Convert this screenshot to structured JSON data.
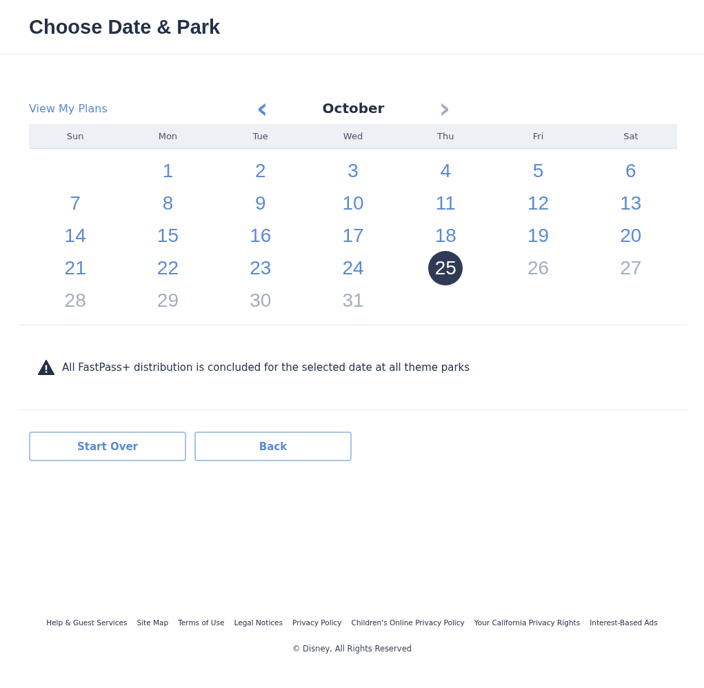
{
  "header": {
    "title": "Choose Date & Park"
  },
  "calendar": {
    "link": "View My Plans",
    "month": "October",
    "prev": {
      "label": "‹",
      "disabled": false
    },
    "next": {
      "label": "›",
      "disabled": true
    },
    "weekdays": [
      "Sun",
      "Mon",
      "Tue",
      "Wed",
      "Thu",
      "Fri",
      "Sat"
    ],
    "days": [
      {
        "kind": "blank"
      },
      {
        "kind": "day",
        "label": "1",
        "disabled": false,
        "selected": false
      },
      {
        "kind": "day",
        "label": "2",
        "disabled": false,
        "selected": false
      },
      {
        "kind": "day",
        "label": "3",
        "disabled": false,
        "selected": false
      },
      {
        "kind": "day",
        "label": "4",
        "disabled": false,
        "selected": false
      },
      {
        "kind": "day",
        "label": "5",
        "disabled": false,
        "selected": false
      },
      {
        "kind": "day",
        "label": "6",
        "disabled": false,
        "selected": false
      },
      {
        "kind": "day",
        "label": "7",
        "disabled": false,
        "selected": false
      },
      {
        "kind": "day",
        "label": "8",
        "disabled": false,
        "selected": false
      },
      {
        "kind": "day",
        "label": "9",
        "disabled": false,
        "selected": false
      },
      {
        "kind": "day",
        "label": "10",
        "disabled": false,
        "selected": false
      },
      {
        "kind": "day",
        "label": "11",
        "disabled": false,
        "selected": false
      },
      {
        "kind": "day",
        "label": "12",
        "disabled": false,
        "selected": false
      },
      {
        "kind": "day",
        "label": "13",
        "disabled": false,
        "selected": false
      },
      {
        "kind": "day",
        "label": "14",
        "disabled": false,
        "selected": false
      },
      {
        "kind": "day",
        "label": "15",
        "disabled": false,
        "selected": false
      },
      {
        "kind": "day",
        "label": "16",
        "disabled": false,
        "selected": false
      },
      {
        "kind": "day",
        "label": "17",
        "disabled": false,
        "selected": false
      },
      {
        "kind": "day",
        "label": "18",
        "disabled": false,
        "selected": false
      },
      {
        "kind": "day",
        "label": "19",
        "disabled": false,
        "selected": false
      },
      {
        "kind": "day",
        "label": "20",
        "disabled": false,
        "selected": false
      },
      {
        "kind": "day",
        "label": "21",
        "disabled": false,
        "selected": false
      },
      {
        "kind": "day",
        "label": "22",
        "disabled": false,
        "selected": false
      },
      {
        "kind": "day",
        "label": "23",
        "disabled": false,
        "selected": false
      },
      {
        "kind": "day",
        "label": "24",
        "disabled": false,
        "selected": false
      },
      {
        "kind": "day",
        "label": "25",
        "disabled": false,
        "selected": true
      },
      {
        "kind": "day",
        "label": "26",
        "disabled": true,
        "selected": false
      },
      {
        "kind": "day",
        "label": "27",
        "disabled": true,
        "selected": false
      },
      {
        "kind": "day",
        "label": "28",
        "disabled": true,
        "selected": false
      },
      {
        "kind": "day",
        "label": "29",
        "disabled": true,
        "selected": false
      },
      {
        "kind": "day",
        "label": "30",
        "disabled": true,
        "selected": false
      },
      {
        "kind": "day",
        "label": "31",
        "disabled": true,
        "selected": false
      }
    ]
  },
  "alert": {
    "message": "All FastPass+ distribution is concluded for the selected date at all theme parks"
  },
  "buttons": [
    "Start Over",
    "Back"
  ],
  "footer": {
    "links": [
      "Help & Guest Services",
      "Site Map",
      "Terms of Use",
      "Legal Notices",
      "Privacy Policy",
      "Children's Online Privacy Policy",
      "Your California Privacy Rights",
      "Interest-Based Ads"
    ],
    "copyright": "© Disney, All Rights Reserved"
  }
}
